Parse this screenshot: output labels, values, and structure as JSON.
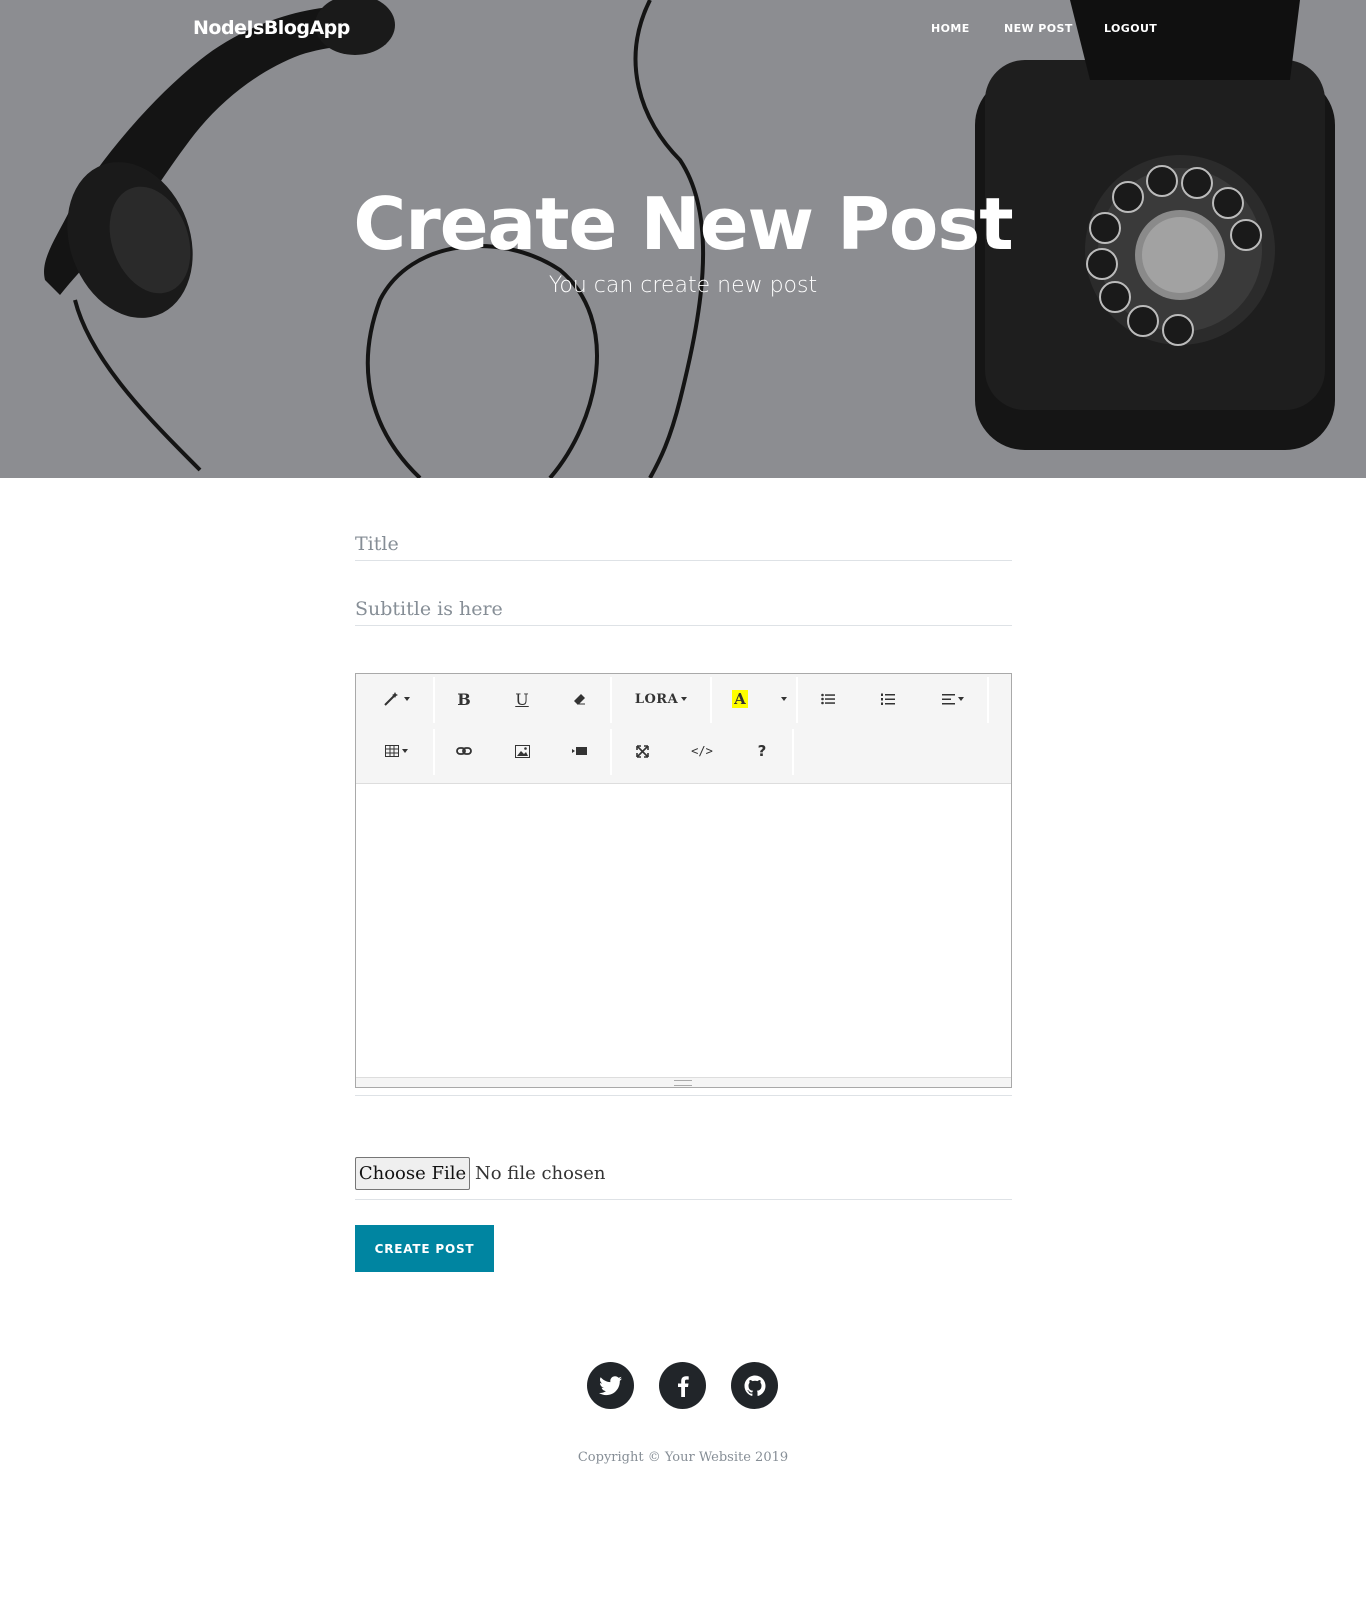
{
  "navbar": {
    "brand": "NodeJsBlogApp",
    "links": [
      "HOME",
      "NEW POST",
      "LOGOUT"
    ]
  },
  "hero": {
    "title": "Create New Post",
    "subtitle": "You can create new post"
  },
  "form": {
    "title_placeholder": "Title",
    "subtitle_placeholder": "Subtitle is here",
    "editor": {
      "font_name": "LORA",
      "toolbar_icons": [
        "magic-icon",
        "bold-icon",
        "underline-icon",
        "eraser-icon",
        "font-name-dropdown",
        "highlight-color-icon",
        "color-dropdown",
        "unordered-list-icon",
        "ordered-list-icon",
        "align-dropdown",
        "table-icon",
        "link-icon",
        "picture-icon",
        "video-icon",
        "fullscreen-icon",
        "code-view-icon",
        "help-icon"
      ],
      "bold": "B",
      "underline": "U",
      "color_letter": "A",
      "code": "</>",
      "help": "?"
    },
    "file": {
      "button_label": "Choose File",
      "status": "No file chosen"
    },
    "submit_label": "CREATE POST"
  },
  "footer": {
    "social": [
      "twitter-icon",
      "facebook-icon",
      "github-icon"
    ],
    "copyright": "Copyright © Your Website 2019"
  },
  "colors": {
    "primary": "#0085a1",
    "hero_overlay": "#8c8d91",
    "dark": "#212529"
  }
}
